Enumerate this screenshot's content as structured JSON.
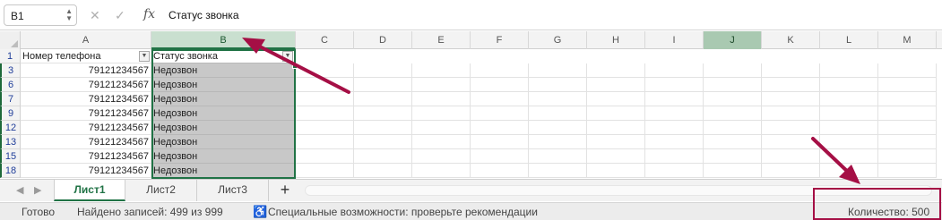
{
  "formula_bar": {
    "name_box": "B1",
    "fx_label": "fx",
    "formula": "Статус звонка"
  },
  "columns": [
    "A",
    "B",
    "C",
    "D",
    "E",
    "F",
    "G",
    "H",
    "I",
    "J",
    "K",
    "L",
    "M"
  ],
  "header_row": {
    "row_num": "1",
    "a": "Номер телефона",
    "b": "Статус звонка"
  },
  "rows": [
    {
      "row_num": "3",
      "phone": "79121234567",
      "status": "Недозвон"
    },
    {
      "row_num": "6",
      "phone": "79121234567",
      "status": "Недозвон"
    },
    {
      "row_num": "7",
      "phone": "79121234567",
      "status": "Недозвон"
    },
    {
      "row_num": "9",
      "phone": "79121234567",
      "status": "Недозвон"
    },
    {
      "row_num": "12",
      "phone": "79121234567",
      "status": "Недозвон"
    },
    {
      "row_num": "13",
      "phone": "79121234567",
      "status": "Недозвон"
    },
    {
      "row_num": "15",
      "phone": "79121234567",
      "status": "Недозвон"
    },
    {
      "row_num": "18",
      "phone": "79121234567",
      "status": "Недозвон"
    }
  ],
  "sheets": [
    "Лист1",
    "Лист2",
    "Лист3"
  ],
  "active_sheet": "Лист1",
  "status_bar": {
    "ready": "Готово",
    "found": "Найдено записей: 499 из 999",
    "accessibility": "Специальные возможности: проверьте рекомендации",
    "count": "Количество: 500"
  },
  "colors": {
    "accent": "#217346",
    "annotation": "#a50f45",
    "selection_fill": "#c8c8c8"
  }
}
